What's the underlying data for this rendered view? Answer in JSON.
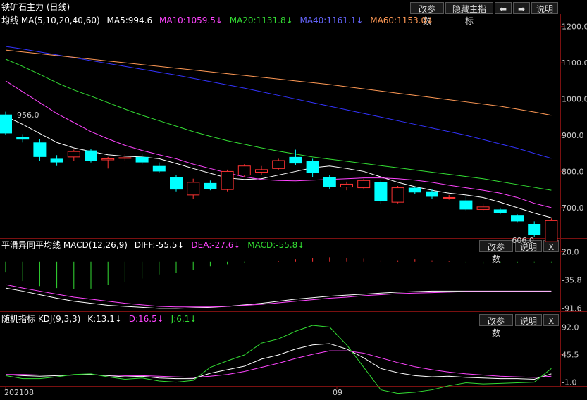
{
  "title": "铁矿石主力 (日线)",
  "toolbar": {
    "modify": "改参数",
    "hide": "隐藏主指标",
    "left": "⬅",
    "right": "➡",
    "help": "说明"
  },
  "ma_header": {
    "label": "均线 MA(5,10,20,40,60)",
    "ma5": "MA5:994.6",
    "ma10": "MA10:1059.5↓",
    "ma20": "MA20:1131.8↓",
    "ma40": "MA40:1161.1↓",
    "ma60": "MA60:1153.0↓"
  },
  "macd_header": {
    "label": "平滑异同平均线 MACD(12,26,9)",
    "diff": "DIFF:-55.5↓",
    "dea": "DEA:-27.6↓",
    "macd": "MACD:-55.8↓"
  },
  "kdj_header": {
    "label": "随机指标 KDJ(9,3,3)",
    "k": "K:13.1↓",
    "d": "D:16.5↓",
    "j": "J:6.1↓"
  },
  "panel_buttons": {
    "modify": "改参数",
    "help": "说明",
    "close": "X"
  },
  "x_labels": [
    "202108",
    "09"
  ],
  "colors": {
    "up": "#ff3333",
    "down": "#00ffff",
    "ma5": "#ffffff",
    "ma10": "#ff44ff",
    "ma20": "#33dd33",
    "ma40": "#3333ff",
    "ma60": "#ff9955"
  },
  "chart_data": [
    {
      "type": "candlestick",
      "ylim": [
        620,
        1215
      ],
      "yticks": [
        "1200.0",
        "1100.0",
        "1000.0",
        "900.0",
        "800.0",
        "700.0"
      ],
      "annotations": [
        "956.0",
        "606.0"
      ],
      "candles": [
        {
          "o": 957,
          "h": 965,
          "l": 900,
          "c": 905
        },
        {
          "o": 895,
          "h": 903,
          "l": 880,
          "c": 888
        },
        {
          "o": 880,
          "h": 890,
          "l": 830,
          "c": 840
        },
        {
          "o": 835,
          "h": 845,
          "l": 815,
          "c": 825
        },
        {
          "o": 840,
          "h": 860,
          "l": 830,
          "c": 855
        },
        {
          "o": 858,
          "h": 862,
          "l": 825,
          "c": 830
        },
        {
          "o": 832,
          "h": 840,
          "l": 808,
          "c": 835
        },
        {
          "o": 838,
          "h": 848,
          "l": 830,
          "c": 838
        },
        {
          "o": 840,
          "h": 850,
          "l": 820,
          "c": 825
        },
        {
          "o": 815,
          "h": 825,
          "l": 795,
          "c": 800
        },
        {
          "o": 785,
          "h": 790,
          "l": 745,
          "c": 750
        },
        {
          "o": 735,
          "h": 780,
          "l": 725,
          "c": 770
        },
        {
          "o": 768,
          "h": 775,
          "l": 748,
          "c": 752
        },
        {
          "o": 750,
          "h": 805,
          "l": 745,
          "c": 800
        },
        {
          "o": 790,
          "h": 820,
          "l": 785,
          "c": 815
        },
        {
          "o": 798,
          "h": 815,
          "l": 790,
          "c": 805
        },
        {
          "o": 808,
          "h": 835,
          "l": 805,
          "c": 830
        },
        {
          "o": 840,
          "h": 860,
          "l": 818,
          "c": 822
        },
        {
          "o": 830,
          "h": 835,
          "l": 785,
          "c": 795
        },
        {
          "o": 785,
          "h": 790,
          "l": 752,
          "c": 757
        },
        {
          "o": 757,
          "h": 772,
          "l": 748,
          "c": 765
        },
        {
          "o": 755,
          "h": 780,
          "l": 750,
          "c": 775
        },
        {
          "o": 770,
          "h": 775,
          "l": 710,
          "c": 718
        },
        {
          "o": 715,
          "h": 760,
          "l": 712,
          "c": 755
        },
        {
          "o": 755,
          "h": 758,
          "l": 738,
          "c": 742
        },
        {
          "o": 745,
          "h": 750,
          "l": 725,
          "c": 730
        },
        {
          "o": 728,
          "h": 735,
          "l": 722,
          "c": 728
        },
        {
          "o": 720,
          "h": 732,
          "l": 690,
          "c": 695
        },
        {
          "o": 695,
          "h": 712,
          "l": 690,
          "c": 702
        },
        {
          "o": 695,
          "h": 700,
          "l": 682,
          "c": 685
        },
        {
          "o": 678,
          "h": 682,
          "l": 660,
          "c": 662
        },
        {
          "o": 655,
          "h": 662,
          "l": 620,
          "c": 625
        },
        {
          "o": 606,
          "h": 670,
          "l": 606,
          "c": 664
        }
      ],
      "series": [
        {
          "name": "MA5",
          "values": [
            952,
            930,
            905,
            880,
            865,
            855,
            846,
            842,
            840,
            835,
            822,
            808,
            795,
            782,
            778,
            780,
            790,
            800,
            810,
            815,
            808,
            800,
            785,
            770,
            758,
            748,
            740,
            735,
            728,
            715,
            700,
            685,
            672
          ]
        },
        {
          "name": "MA10",
          "values": [
            1050,
            1020,
            990,
            960,
            935,
            910,
            890,
            872,
            858,
            846,
            835,
            820,
            808,
            796,
            785,
            778,
            775,
            774,
            776,
            778,
            780,
            782,
            782,
            780,
            776,
            770,
            762,
            755,
            748,
            740,
            728,
            712,
            700
          ]
        },
        {
          "name": "MA20",
          "values": [
            1110,
            1090,
            1068,
            1045,
            1025,
            1008,
            990,
            972,
            955,
            940,
            925,
            910,
            897,
            885,
            875,
            865,
            856,
            848,
            840,
            834,
            828,
            822,
            816,
            810,
            804,
            798,
            792,
            786,
            780,
            772,
            764,
            756,
            748
          ]
        },
        {
          "name": "MA40",
          "values": [
            1145,
            1138,
            1130,
            1122,
            1114,
            1106,
            1098,
            1090,
            1082,
            1074,
            1066,
            1057,
            1048,
            1039,
            1030,
            1020,
            1010,
            1000,
            990,
            980,
            970,
            960,
            950,
            940,
            930,
            920,
            910,
            900,
            888,
            876,
            864,
            850,
            836
          ]
        },
        {
          "name": "MA60",
          "values": [
            1135,
            1130,
            1125,
            1120,
            1115,
            1110,
            1105,
            1100,
            1095,
            1090,
            1085,
            1080,
            1075,
            1070,
            1065,
            1060,
            1055,
            1050,
            1045,
            1040,
            1034,
            1028,
            1022,
            1016,
            1010,
            1004,
            998,
            992,
            986,
            980,
            972,
            964,
            955
          ]
        }
      ]
    },
    {
      "type": "bar",
      "ylim": [
        -95,
        22
      ],
      "yticks": [
        "20.0",
        "-35.8",
        "-91.6"
      ],
      "macd": [
        -20,
        -38,
        -48,
        -52,
        -54,
        -53,
        -46,
        -40,
        -33,
        -25,
        -22,
        -16,
        -9,
        -5,
        -1,
        0,
        2,
        5,
        7,
        9,
        8,
        6,
        3,
        3,
        5,
        3,
        1,
        -2,
        -4,
        -3,
        -2,
        -1,
        -1
      ],
      "series": [
        {
          "name": "DIFF",
          "values": [
            -52,
            -58,
            -65,
            -72,
            -78,
            -82,
            -86,
            -88,
            -90,
            -92,
            -92,
            -91,
            -90,
            -88,
            -85,
            -82,
            -78,
            -74,
            -71,
            -68,
            -66,
            -64,
            -62,
            -60,
            -59,
            -58,
            -58,
            -58,
            -58,
            -58,
            -58,
            -58,
            -58
          ]
        },
        {
          "name": "DEA",
          "values": [
            -45,
            -52,
            -58,
            -64,
            -70,
            -74,
            -78,
            -82,
            -85,
            -88,
            -89,
            -89,
            -89,
            -88,
            -86,
            -84,
            -81,
            -78,
            -75,
            -72,
            -70,
            -67,
            -65,
            -63,
            -62,
            -61,
            -60,
            -59,
            -59,
            -59,
            -59,
            -59,
            -59
          ]
        }
      ]
    },
    {
      "type": "line",
      "ylim": [
        -5,
        95
      ],
      "yticks": [
        "92.0",
        "45.5",
        "-1.0"
      ],
      "series": [
        {
          "name": "K",
          "values": [
            12,
            10,
            9,
            10,
            11,
            12,
            10,
            8,
            9,
            6,
            5,
            5,
            14,
            20,
            26,
            38,
            45,
            55,
            62,
            64,
            55,
            40,
            22,
            15,
            10,
            8,
            9,
            7,
            6,
            5,
            5,
            4,
            13
          ]
        },
        {
          "name": "D",
          "values": [
            12,
            12,
            11,
            11,
            11,
            11,
            11,
            10,
            10,
            9,
            8,
            7,
            9,
            12,
            17,
            24,
            31,
            39,
            46,
            52,
            52,
            48,
            40,
            32,
            25,
            20,
            16,
            13,
            11,
            9,
            8,
            7,
            9
          ]
        },
        {
          "name": "J",
          "values": [
            10,
            5,
            5,
            8,
            12,
            13,
            8,
            4,
            6,
            1,
            -1,
            2,
            24,
            35,
            45,
            65,
            72,
            85,
            95,
            92,
            62,
            24,
            -14,
            -20,
            -18,
            -14,
            -7,
            -2,
            -4,
            -3,
            -2,
            -1,
            22
          ]
        }
      ]
    }
  ]
}
